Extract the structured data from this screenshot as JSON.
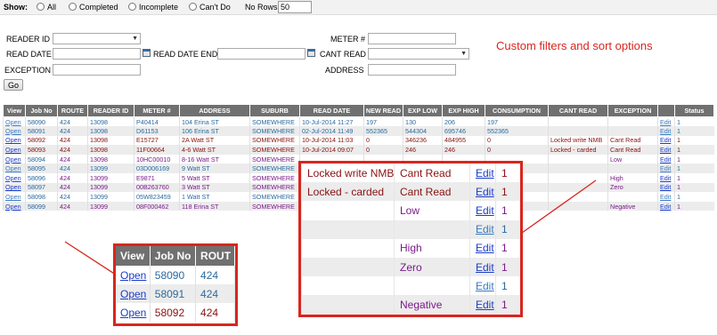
{
  "show_bar": {
    "show_label": "Show:",
    "options": [
      "All",
      "Completed",
      "Incomplete",
      "Can't Do"
    ],
    "no_rows_label": "No Rows",
    "no_rows_value": "50"
  },
  "filters": {
    "reader_id_label": "READER ID",
    "read_date_label": "READ DATE",
    "read_date_end_label": "READ DATE END",
    "exception_label": "EXCEPTION",
    "meter_label": "METER #",
    "cant_read_label": "CANT READ",
    "address_label": "ADDRESS",
    "go_label": "Go",
    "note": "Custom filters and sort options"
  },
  "colors": {
    "header_bg": "#707070",
    "annotation_red": "#d8261e",
    "row_red": "#8a1010",
    "row_blue": "#2a6aa0",
    "row_purple": "#7a1a8a",
    "link_blue": "#1a3cc8"
  },
  "table": {
    "columns": [
      "View",
      "Job No",
      "ROUTE",
      "READER ID",
      "METER #",
      "ADDRESS",
      "SUBURB",
      "READ DATE",
      "NEW READ",
      "EXP LOW",
      "EXP HIGH",
      "CONSUMPTION",
      "CANT READ",
      "EXCEPTION",
      "",
      "Status"
    ],
    "rows": [
      {
        "style": "blue",
        "cells": [
          "Open",
          "58090",
          "424",
          "13098",
          "P40414",
          "104 Erina ST",
          "SOMEWHERE",
          "10-Jul-2014 11:27",
          "197",
          "130",
          "206",
          "197",
          "",
          "",
          "Edit",
          "1"
        ]
      },
      {
        "style": "blue",
        "cells": [
          "Open",
          "58091",
          "424",
          "13098",
          "D61153",
          "106 Erina ST",
          "SOMEWHERE",
          "02-Jul-2014 11:49",
          "552365",
          "544304",
          "695746",
          "552365",
          "",
          "",
          "Edit",
          "1"
        ]
      },
      {
        "style": "red",
        "cells": [
          "Open",
          "58092",
          "424",
          "13098",
          "E15727",
          "2A Watt ST",
          "SOMEWHERE",
          "10-Jul-2014 11:03",
          "0",
          "346236",
          "484955",
          "0",
          "Locked write NMB",
          "Cant Read",
          "Edit",
          "1"
        ]
      },
      {
        "style": "red",
        "cells": [
          "Open",
          "58093",
          "424",
          "13098",
          "11F00664",
          "4-6 Watt ST",
          "SOMEWHERE",
          "10-Jul-2014 09:07",
          "0",
          "246",
          "246",
          "0",
          "Locked - carded",
          "Cant Read",
          "Edit",
          "1"
        ]
      },
      {
        "style": "purple",
        "cells": [
          "Open",
          "58094",
          "424",
          "13098",
          "10HC00010",
          "8-16 Watt ST",
          "SOMEWHERE",
          "",
          "",
          "",
          "",
          "",
          "",
          "Low",
          "Edit",
          "1"
        ]
      },
      {
        "style": "blue",
        "cells": [
          "Open",
          "58095",
          "424",
          "13099",
          "03D006169",
          "9 Watt ST",
          "SOMEWHERE",
          "",
          "",
          "",
          "",
          "",
          "",
          "",
          "Edit",
          "1"
        ]
      },
      {
        "style": "purple",
        "cells": [
          "Open",
          "58096",
          "424",
          "13099",
          "E9871",
          "5 Watt ST",
          "SOMEWHERE",
          "",
          "",
          "",
          "",
          "",
          "",
          "High",
          "Edit",
          "1"
        ]
      },
      {
        "style": "purple",
        "cells": [
          "Open",
          "58097",
          "424",
          "13099",
          "00B263760",
          "3 Watt ST",
          "SOMEWHERE",
          "",
          "",
          "",
          "",
          "",
          "",
          "Zero",
          "Edit",
          "1"
        ]
      },
      {
        "style": "blue",
        "cells": [
          "Open",
          "58098",
          "424",
          "13099",
          "05W823459",
          "1 Watt ST",
          "SOMEWHERE",
          "",
          "",
          "",
          "",
          "",
          "",
          "",
          "Edit",
          "1"
        ]
      },
      {
        "style": "purple",
        "cells": [
          "Open",
          "58099",
          "424",
          "13099",
          "08F000462",
          "118 Erina ST",
          "SOMEWHERE",
          "",
          "",
          "",
          "",
          "",
          "",
          "Negative",
          "Edit",
          "1"
        ]
      }
    ]
  },
  "zoom_left": {
    "columns": [
      "View",
      "Job No",
      "ROUT"
    ],
    "rows": [
      {
        "style": "blue",
        "cells": [
          "Open",
          "58090",
          "424"
        ]
      },
      {
        "style": "blue",
        "cells": [
          "Open",
          "58091",
          "424"
        ]
      },
      {
        "style": "red",
        "cells": [
          "Open",
          "58092",
          "424"
        ]
      }
    ]
  },
  "zoom_right": {
    "rows": [
      {
        "style": "red",
        "cells": [
          "Locked write NMB",
          "Cant Read",
          "Edit",
          "1"
        ]
      },
      {
        "style": "red",
        "cells": [
          "Locked - carded",
          "Cant Read",
          "Edit",
          "1"
        ]
      },
      {
        "style": "purple",
        "cells": [
          "",
          "Low",
          "Edit",
          "1"
        ]
      },
      {
        "style": "blue",
        "cells": [
          "",
          "",
          "Edit",
          "1"
        ]
      },
      {
        "style": "purple",
        "cells": [
          "",
          "High",
          "Edit",
          "1"
        ]
      },
      {
        "style": "purple",
        "cells": [
          "",
          "Zero",
          "Edit",
          "1"
        ]
      },
      {
        "style": "blue",
        "cells": [
          "",
          "",
          "Edit",
          "1"
        ]
      },
      {
        "style": "purple",
        "cells": [
          "",
          "Negative",
          "Edit",
          "1"
        ]
      }
    ]
  }
}
